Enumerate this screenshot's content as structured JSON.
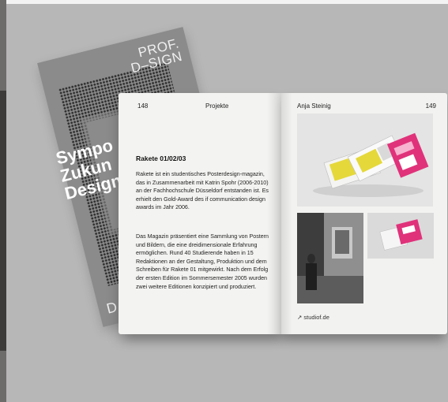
{
  "back_cover": {
    "brand": "PROF.\nD–SIGN",
    "title_lines": [
      "Sympo",
      "Zukun",
      "Design"
    ],
    "footer_letter": "D"
  },
  "left_page": {
    "page_number": "148",
    "section": "Projekte",
    "article_title": "Rakete 01/02/03",
    "paragraph_1": "Rakete ist ein studentisches Posterdesign-magazin, das in Zusammenarbeit mit Katrin Spohr (2006-2010) an der Fachhochschule Düsseldorf entstanden ist. Es erhielt den Gold-Award des if communication design awards im Jahr 2006.",
    "paragraph_2": "Das Magazin präsentiert eine Sammlung von Postern und Bildern, die eine dreidimensionale Erfahrung ermöglichen. Rund 40 Studierende haben in 15 Redaktionen an der Gestaltung, Produktion und dem Schreiben für Rakete 01 mitgewirkt. Nach dem Erfolg der ersten Edition im Sommersemester 2005 wurden zwei weitere Editionen konzipiert und produziert."
  },
  "right_page": {
    "author": "Anja Steinig",
    "page_number": "149",
    "credit": "↗ studiof.de"
  },
  "colors": {
    "background": "#b7b7b7",
    "paper": "#f3f3f1",
    "back_cover": "#8b8b8b",
    "pink_magazine": "#e0327a",
    "yellow_magazine": "#e5d83a"
  }
}
